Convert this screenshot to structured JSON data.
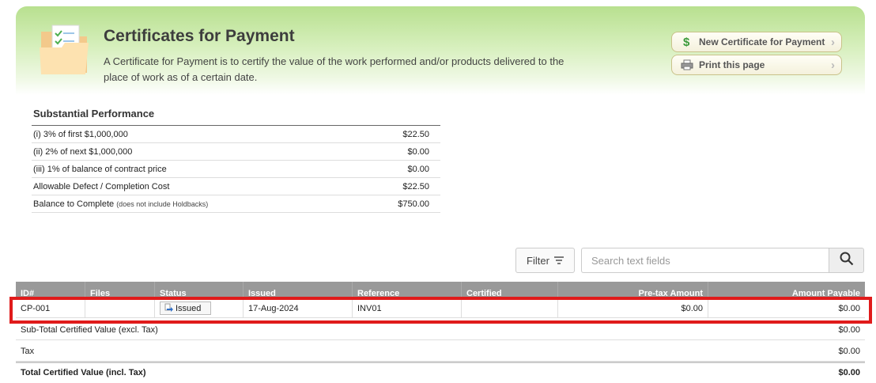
{
  "header": {
    "title": "Certificates for Payment",
    "description": "A Certificate for Payment is to certify the value of the work performed and/or products delivered to the place of work as of a certain date.",
    "new_button": "New Certificate for Payment",
    "print_button": "Print this page",
    "icons": {
      "folder": "folder-checklist-icon",
      "new": "dollar-icon",
      "print": "printer-icon",
      "chevron": "chevron-right-icon"
    }
  },
  "substantial_performance": {
    "title": "Substantial Performance",
    "rows": [
      {
        "label": "(i) 3% of first $1,000,000",
        "note": "",
        "value": "$22.50"
      },
      {
        "label": "(ii) 2% of next $1,000,000",
        "note": "",
        "value": "$0.00"
      },
      {
        "label": "(iii) 1% of balance of contract price",
        "note": "",
        "value": "$0.00"
      },
      {
        "label": "Allowable Defect / Completion Cost",
        "note": "",
        "value": "$22.50"
      },
      {
        "label": "Balance to Complete",
        "note": "(does not include Holdbacks)",
        "value": "$750.00"
      }
    ]
  },
  "toolbar": {
    "filter_label": "Filter",
    "search_placeholder": "Search text fields"
  },
  "table": {
    "columns": [
      "ID#",
      "Files",
      "Status",
      "Issued",
      "Reference",
      "Certified",
      "Pre-tax Amount",
      "Amount Payable"
    ],
    "rows": [
      {
        "id": "CP-001",
        "files": "",
        "status": "Issued",
        "issued": "17-Aug-2024",
        "reference": "INV01",
        "certified": "",
        "pretax": "$0.00",
        "payable": "$0.00"
      }
    ],
    "summary": [
      {
        "label": "Sub-Total Certified Value (excl. Tax)",
        "value": "$0.00"
      },
      {
        "label": "Tax",
        "value": "$0.00"
      },
      {
        "label": "Total Certified Value (incl. Tax)",
        "value": "$0.00"
      }
    ]
  },
  "colors": {
    "highlight": "#e01b1b",
    "banner": "#b8e08f",
    "table_header": "#999999"
  }
}
